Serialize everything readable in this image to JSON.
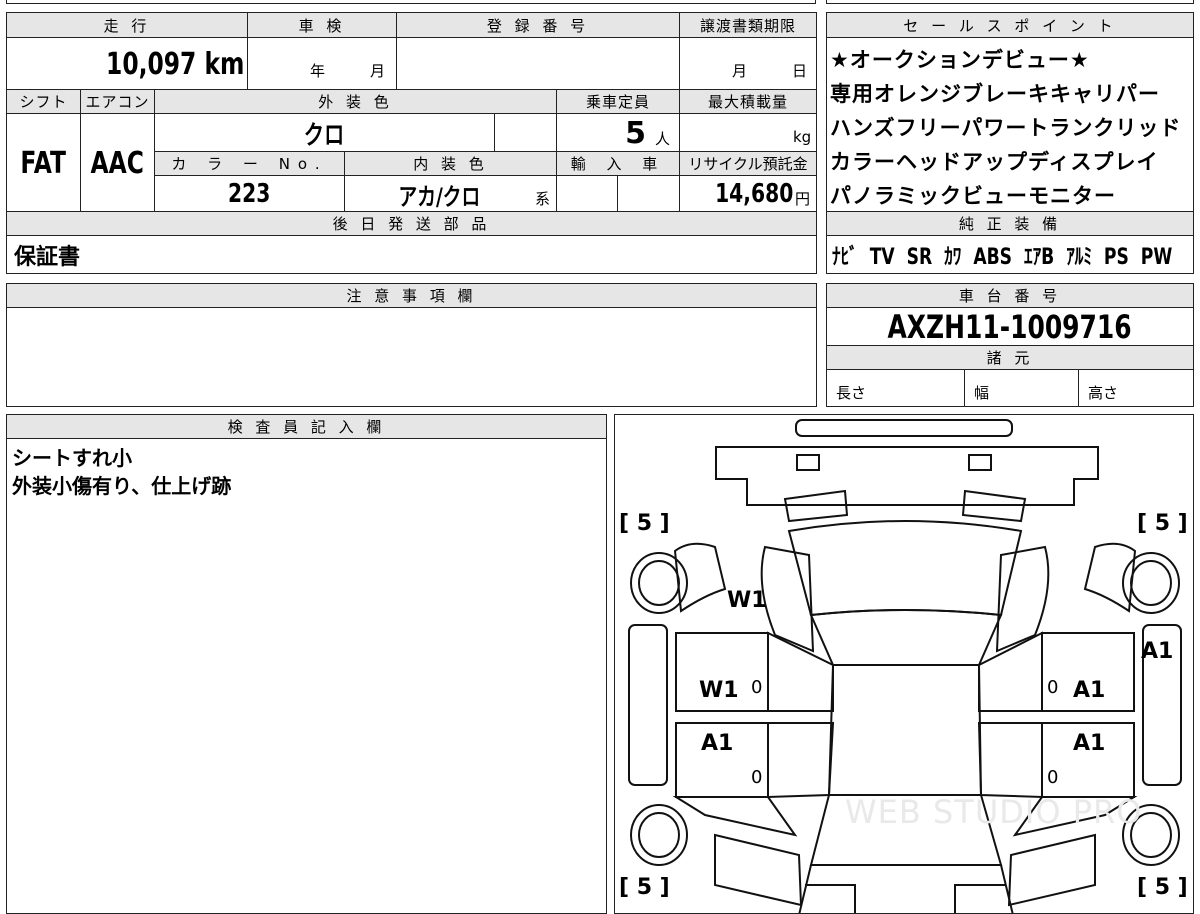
{
  "top": {
    "mileage_label": "走 行",
    "mileage_value": "10,097 km",
    "shaken_label": "車 検",
    "shaken_year_unit": "年",
    "shaken_month_unit": "月",
    "reg_label": "登 録 番 号",
    "transfer_label": "譲渡書類期限",
    "transfer_month_unit": "月",
    "transfer_day_unit": "日"
  },
  "vehicle": {
    "shift_label": "シフト",
    "shift_value": "FAT",
    "ac_label": "エアコン",
    "ac_value": "AAC",
    "ext_color_label": "外 装 色",
    "ext_color_value": "クロ",
    "capacity_label": "乗車定員",
    "capacity_value": "5",
    "capacity_unit": "人",
    "max_load_label": "最大積載量",
    "max_load_unit": "kg",
    "color_no_label": "カ ラ ー No.",
    "color_no_value": "223",
    "int_color_label": "内 装 色",
    "int_color_value": "アカ/クロ",
    "int_color_suffix": "系",
    "import_label": "輸 入 車",
    "recycle_label": "リサイクル預託金",
    "recycle_value": "14,680",
    "recycle_unit": "円"
  },
  "parts": {
    "label": "後 日 発 送 部 品",
    "value": "保証書"
  },
  "sales": {
    "label": "セ ー ル ス ポ イ ン ト",
    "points": [
      "★オークションデビュー★",
      "専用オレンジブレーキキャリパー",
      "ハンズフリーパワートランクリッド",
      "カラーヘッドアップディスプレイ",
      "パノラミックビューモニター"
    ]
  },
  "equipment": {
    "label": "純 正 装 備",
    "items": [
      "ﾅﾋﾞ",
      "TV",
      "SR",
      "ｶﾜ",
      "ABS",
      "ｴｱB",
      "ｱﾙﾐ",
      "PS",
      "PW"
    ]
  },
  "notes": {
    "label": "注 意 事 項 欄"
  },
  "chassis": {
    "label": "車 台 番 号",
    "value": "AXZH11-1009716",
    "spec_label": "諸 元",
    "length_label": "長さ",
    "width_label": "幅",
    "height_label": "高さ"
  },
  "inspector": {
    "label": "検 査 員 記 入 欄",
    "lines": [
      "シートすれ小",
      "外装小傷有り、仕上げ跡"
    ]
  },
  "diagram": {
    "tire_tl": "[ 5 ]",
    "tire_tr": "[ 5 ]",
    "tire_bl": "[ 5 ]",
    "tire_br": "[ 5 ]",
    "marks": {
      "hood_left": "W1",
      "front_left_door": "W1",
      "rear_left_door": "A1",
      "front_right_fender": "A1",
      "front_right_door": "A1",
      "rear_right_door": "A1",
      "zero": "0"
    },
    "watermark": "WEB STUDIO PRO"
  }
}
